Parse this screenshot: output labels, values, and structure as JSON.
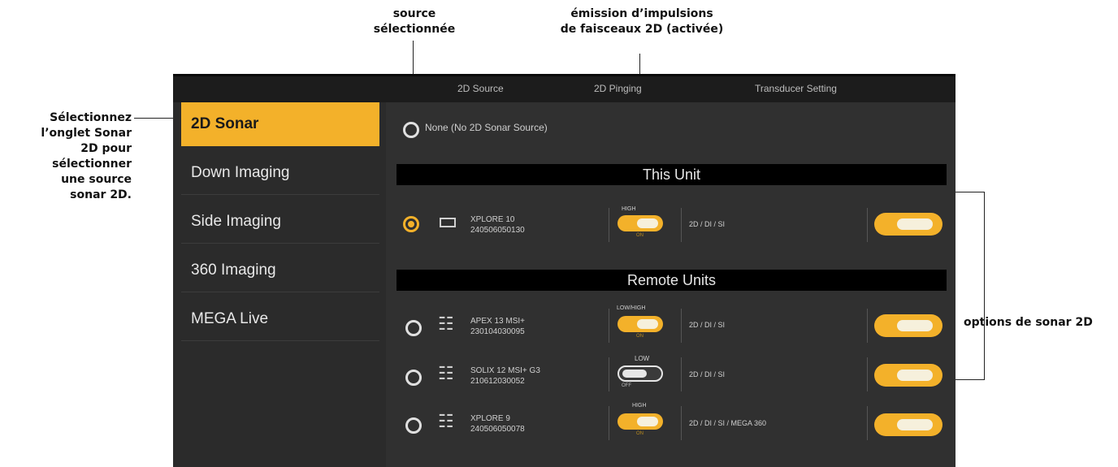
{
  "callouts": {
    "source": "source\nsélectionnée",
    "pinging": "émission d’impulsions\nde faisceaux 2D (activée)",
    "tab": "Sélectionnez\nl’onglet Sonar\n2D pour\nsélectionner\nune source\nsonar 2D.",
    "options": "options de sonar 2D"
  },
  "top_tabs": [
    "2D Source",
    "2D Pinging",
    "Transducer Setting"
  ],
  "sidebar": [
    "2D Sonar",
    "Down Imaging",
    "Side Imaging",
    "360 Imaging",
    "MEGA Live"
  ],
  "none_option": "None (No 2D Sonar Source)",
  "sections": {
    "this_unit": "This Unit",
    "remote_units": "Remote Units"
  },
  "this_unit": {
    "name": "XPLORE 10",
    "serial": "240506050130",
    "ping_level": "HIGH",
    "ping_state": "ON",
    "modes": "2D / DI / SI"
  },
  "remote_units": [
    {
      "name": "APEX 13 MSI+",
      "serial": "230104030095",
      "ping_level": "LOW/HIGH",
      "ping_state": "ON",
      "modes": "2D / DI / SI"
    },
    {
      "name": "SOLIX 12 MSI+ G3",
      "serial": "210612030052",
      "ping_level": "LOW",
      "ping_state": "OFF",
      "modes": "2D / DI / SI"
    },
    {
      "name": "XPLORE 9",
      "serial": "240506050078",
      "ping_level": "HIGH",
      "ping_state": "ON",
      "modes": "2D / DI / SI / MEGA 360"
    }
  ],
  "colors": {
    "accent": "#f3b12a",
    "background": "#303030"
  }
}
